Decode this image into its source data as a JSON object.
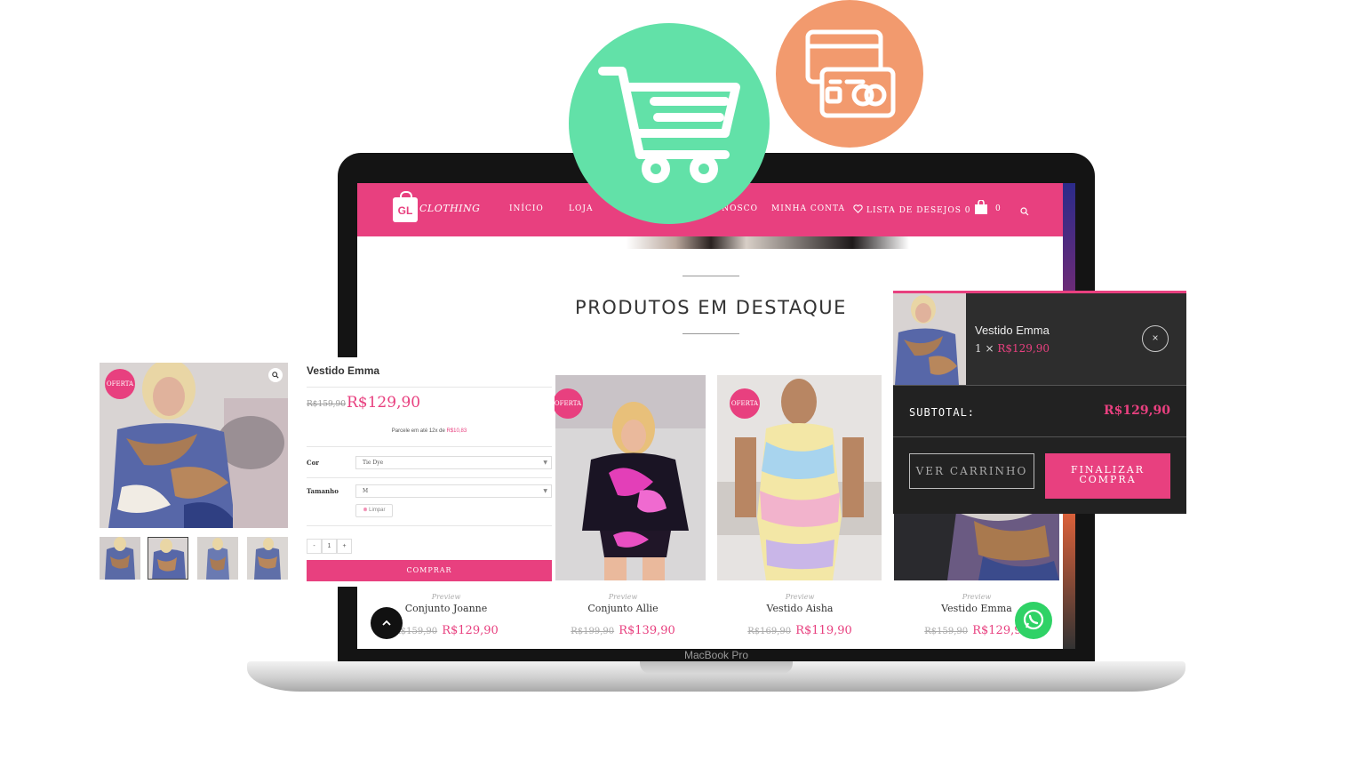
{
  "site": {
    "logo_mark": "GL",
    "logo_text": "CLOTHING",
    "nav": [
      {
        "label": "INÍCIO"
      },
      {
        "label": "LOJA"
      },
      {
        "label": "CONOSCO"
      },
      {
        "label": "MINHA CONTA"
      },
      {
        "label": "LISTA DE DESEJOS 0"
      }
    ],
    "cart_count": "0",
    "section_title": "PRODUTOS EM DESTAQUE"
  },
  "products": [
    {
      "preview": "Preview",
      "name": "Conjunto Joanne",
      "old_price": "R$159,90",
      "price": "R$129,90"
    },
    {
      "preview": "Preview",
      "name": "Conjunto Allie",
      "old_price": "R$199,90",
      "price": "R$139,90",
      "badge": "OFERTA"
    },
    {
      "preview": "Preview",
      "name": "Vestido Aisha",
      "old_price": "R$169,90",
      "price": "R$119,90",
      "badge": "OFERTA"
    },
    {
      "preview": "Preview",
      "name": "Vestido Emma",
      "old_price": "R$159,90",
      "price": "R$129,90"
    }
  ],
  "detail": {
    "badge": "OFERTA",
    "title": "Vestido Emma",
    "old_price": "R$159,90",
    "price": "R$129,90",
    "installments_text": "Parcele em até 12x de",
    "installments_value": "R$10,83",
    "color_label": "Cor",
    "color_value": "Tie Dye",
    "size_label": "Tamanho",
    "size_value": "M",
    "clear_label": "Limpar",
    "qty_minus": "-",
    "qty_value": "1",
    "qty_plus": "+",
    "buy_label": "COMPRAR"
  },
  "mini_cart": {
    "item_name": "Vestido Emma",
    "item_qty": "1 ×",
    "item_price": "R$129,90",
    "remove": "×",
    "subtotal_label": "SUBTOTAL:",
    "subtotal_value": "R$129,90",
    "view_cart_label": "VER CARRINHO",
    "checkout_line1": "FINALIZAR",
    "checkout_line2": "COMPRA"
  },
  "laptop_brand": "MacBook Pro",
  "colors": {
    "brand_pink": "#e8407f",
    "green_badge": "#62e1a8",
    "orange_badge": "#f29a6e",
    "whatsapp": "#2fd266"
  },
  "icons": [
    "shopping-cart-icon",
    "payment-cards-icon",
    "heart-icon",
    "bag-icon",
    "search-icon",
    "zoom-icon",
    "chevron-up-icon",
    "whatsapp-icon",
    "close-icon"
  ]
}
